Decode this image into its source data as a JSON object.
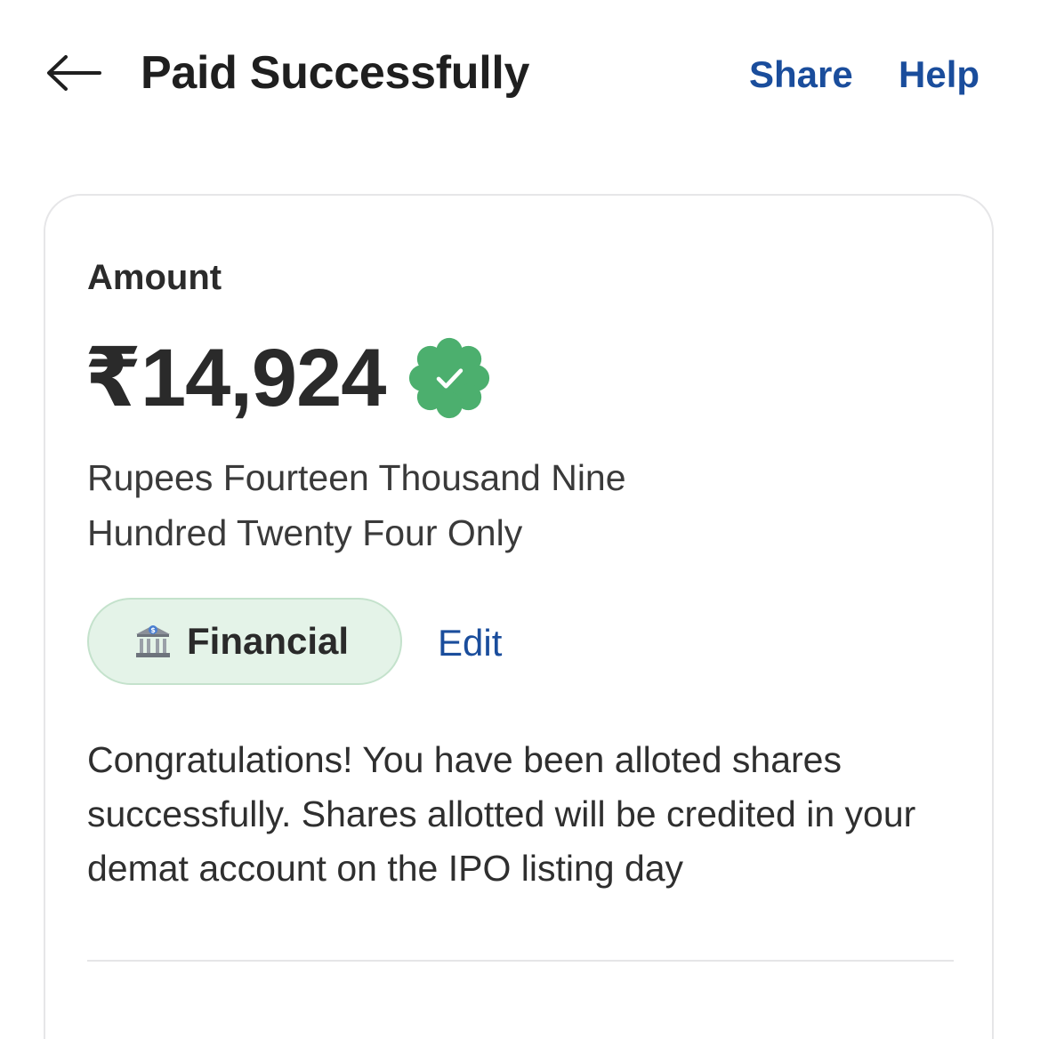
{
  "header": {
    "title": "Paid Successfully",
    "share_label": "Share",
    "help_label": "Help",
    "back_icon": "arrow-left-icon"
  },
  "colors": {
    "accent_blue": "#1a4d9c",
    "verified_green": "#4caf6e",
    "chip_background": "#e4f3e8",
    "chip_border": "#c4e2cc"
  },
  "payment": {
    "amount_label": "Amount",
    "amount": "₹14,924",
    "verified_icon": "verified-check-badge-icon",
    "amount_in_words": "Rupees Fourteen Thousand Nine Hundred Twenty Four Only",
    "category": {
      "icon": "bank-building-icon",
      "label": "Financial"
    },
    "edit_label": "Edit",
    "message": "Congratulations! You have been alloted shares successfully. Shares allotted will be credited in your demat account on the IPO listing day"
  }
}
